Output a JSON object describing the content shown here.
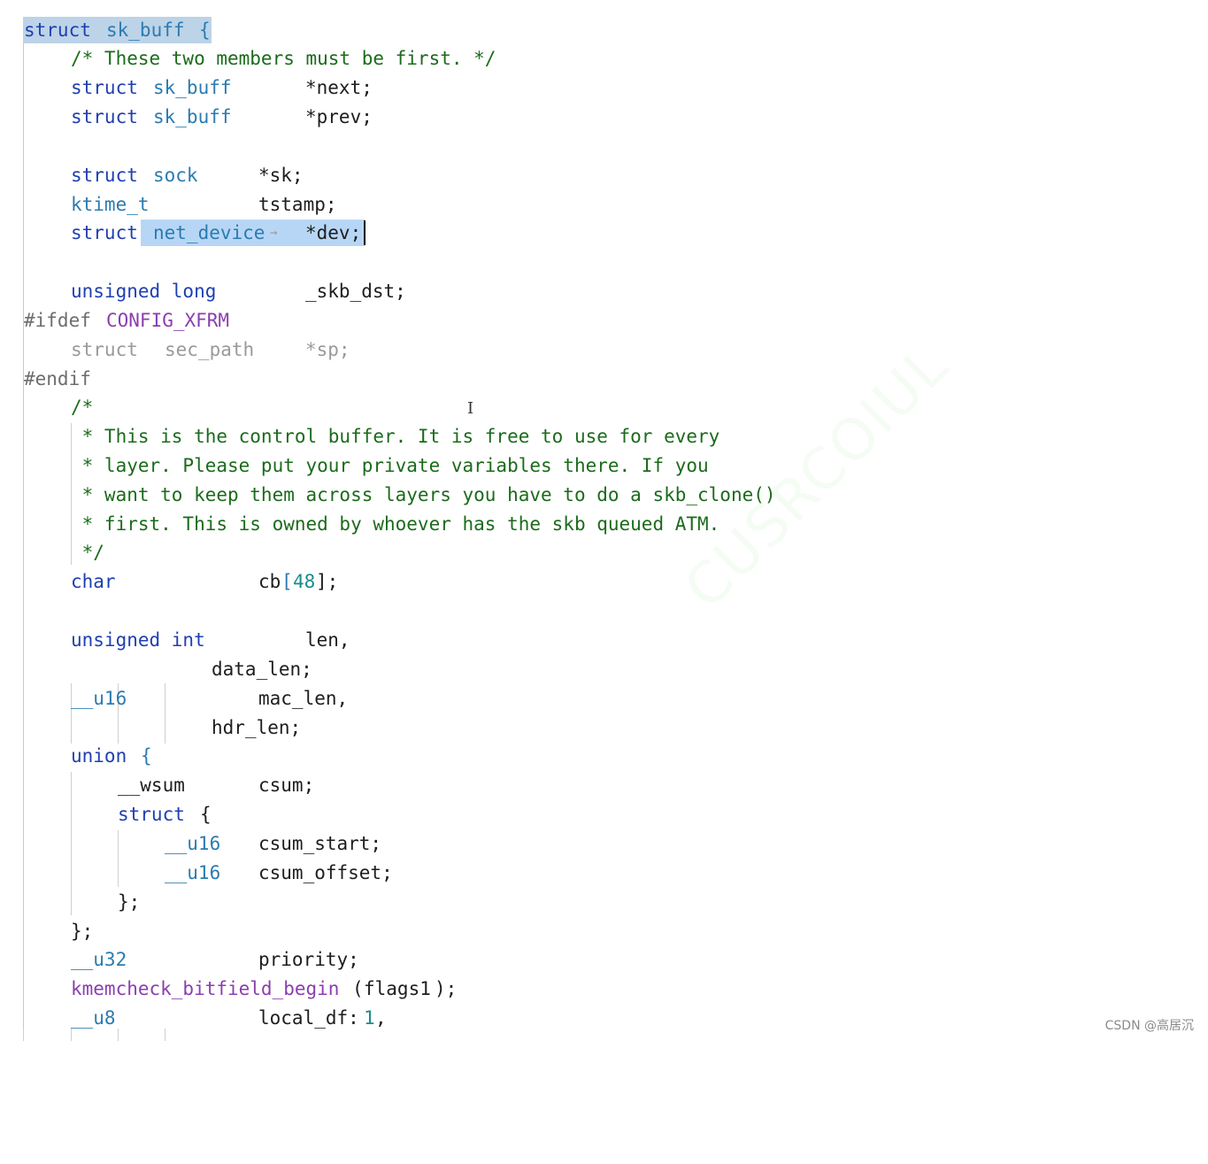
{
  "colors": {
    "keyword": "#1f3fb0",
    "type": "#2b7bb0",
    "comment": "#1b6b1b",
    "preprocessor": "#6d6d6d",
    "macro": "#8b3fae",
    "number": "#1a8c8c",
    "disabled": "#9a9a9a",
    "selection": "#b7d6f5"
  },
  "code": {
    "l1": {
      "kw": "struct",
      "ty": "sk_buff",
      "punct": "{"
    },
    "l2": {
      "comment": "/* These two members must be first. */"
    },
    "l3": {
      "kw": "struct",
      "ty": "sk_buff",
      "name": "*next;"
    },
    "l4": {
      "kw": "struct",
      "ty": "sk_buff",
      "name": "*prev;"
    },
    "l5": {
      "kw": "struct",
      "ty": "sock",
      "name": "*sk;"
    },
    "l6": {
      "ty": "ktime_t",
      "name": "tstamp;"
    },
    "l7": {
      "kw": "struct",
      "ty": "net_device",
      "arrow": "→",
      "name": "*dev;"
    },
    "l8": {
      "kw": "unsigned long",
      "name": "_skb_dst;"
    },
    "l9": {
      "pp": "#ifdef",
      "mac": "CONFIG_XFRM"
    },
    "l10": {
      "kw": "struct",
      "ty": "sec_path",
      "name": "*sp;"
    },
    "l11": {
      "pp": "#endif"
    },
    "l12": {
      "comment": "/*"
    },
    "l13": {
      "comment": " * This is the control buffer. It is free to use for every"
    },
    "l14": {
      "comment": " * layer. Please put your private variables there. If you"
    },
    "l15": {
      "comment": " * want to keep them across layers you have to do a skb_clone()"
    },
    "l16": {
      "comment": " * first. This is owned by whoever has the skb queued ATM."
    },
    "l17": {
      "comment": " */"
    },
    "l18": {
      "kw": "char",
      "name": "cb",
      "open": "[",
      "num": "48",
      "close": "];"
    },
    "l19": {
      "kw": "unsigned int",
      "name": "len,"
    },
    "l20": {
      "name": "data_len;"
    },
    "l21": {
      "ty": "__u16",
      "name": "mac_len,"
    },
    "l22": {
      "name": "hdr_len;"
    },
    "l23": {
      "kw": "union",
      "punct": "{"
    },
    "l24": {
      "ty": "__wsum",
      "name": "csum;"
    },
    "l25": {
      "kw": "struct",
      "punct": "{"
    },
    "l26": {
      "ty": "__u16",
      "name": "csum_start;"
    },
    "l27": {
      "ty": "__u16",
      "name": "csum_offset;"
    },
    "l28": {
      "punct": "};"
    },
    "l29": {
      "punct": "};"
    },
    "l30": {
      "ty": "__u32",
      "name": "priority;"
    },
    "l31": {
      "mac": "kmemcheck_bitfield_begin",
      "open": "(",
      "arg": "flags1",
      "close": ");"
    },
    "l32": {
      "ty": "__u8",
      "name": "local_df:",
      "num": "1",
      "tail": ","
    }
  },
  "ibeam": "I",
  "watermark": "CUSRCOIUL",
  "credit": "CSDN @高居沉"
}
